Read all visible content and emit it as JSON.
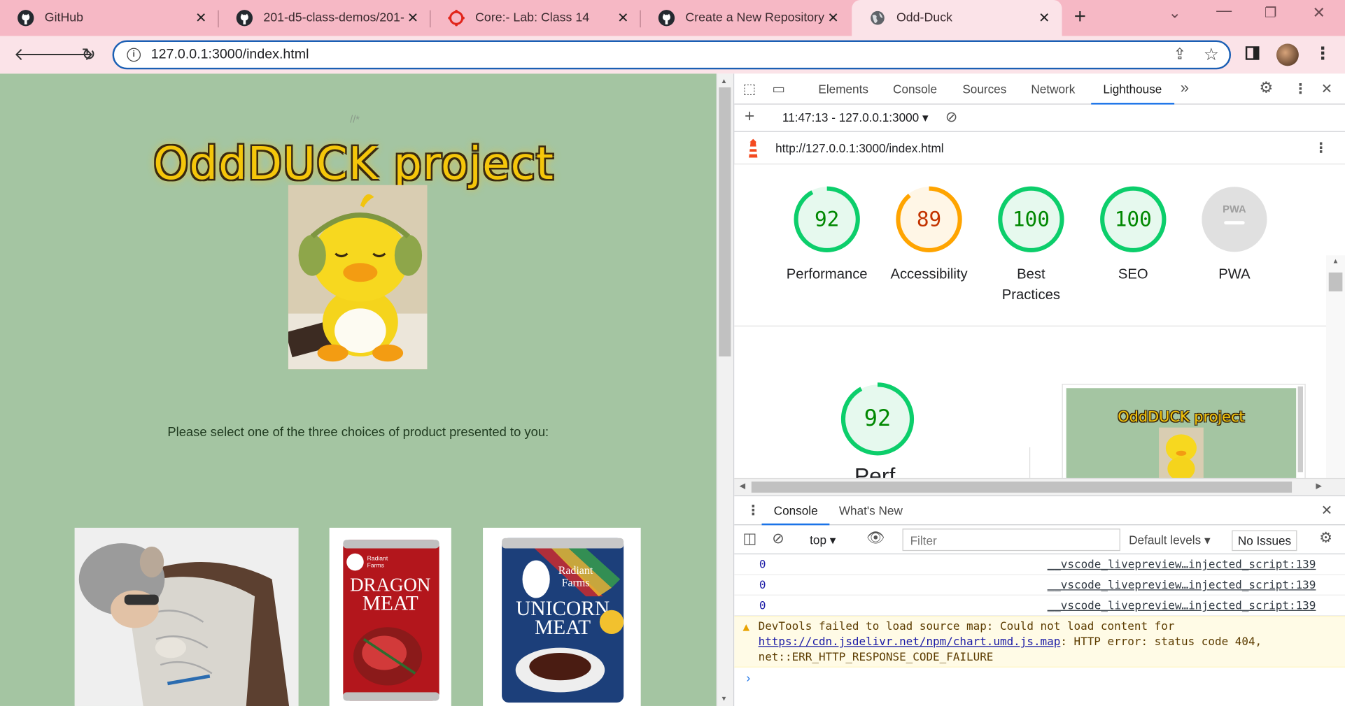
{
  "browser": {
    "tabs": [
      {
        "title": "GitHub",
        "icon": "github-icon"
      },
      {
        "title": "201-d5-class-demos/201-",
        "icon": "github-icon"
      },
      {
        "title": "Core:- Lab: Class 14",
        "icon": "canvas-icon"
      },
      {
        "title": "Create a New Repository",
        "icon": "github-icon"
      },
      {
        "title": "Odd-Duck",
        "icon": "globe-icon"
      }
    ],
    "url": "127.0.0.1:3000/index.html",
    "colors": {
      "tabstrip": "#f6b8c5",
      "toolbar": "#fbe3e8",
      "omnibox_border": "#1a5fb4"
    }
  },
  "page": {
    "comment": "//*",
    "title": "OddDUCK project",
    "prompt": "Please select one of the three choices of product presented to you:",
    "products": [
      {
        "label": "",
        "alt": "sleeping bag"
      },
      {
        "label": "DRAGON MEAT",
        "brand": "Radiant Farms"
      },
      {
        "label": "UNICORN MEAT",
        "brand": "Radiant Farms"
      }
    ],
    "background": "#a4c5a2"
  },
  "devtools": {
    "tabs": [
      "Elements",
      "Console",
      "Sources",
      "Network",
      "Lighthouse"
    ],
    "active_tab": "Lighthouse",
    "report_selector": "11:47:13 - 127.0.0.1:3000",
    "report_url": "http://127.0.0.1:3000/index.html",
    "scores": [
      {
        "label": "Performance",
        "value": "92",
        "color": "#0cce6b",
        "fraction": 0.92
      },
      {
        "label": "Accessibility",
        "value": "89",
        "color": "#ffa400",
        "fraction": 0.89
      },
      {
        "label": "Best Practices",
        "value": "100",
        "color": "#0cce6b",
        "fraction": 1.0
      },
      {
        "label": "SEO",
        "value": "100",
        "color": "#0cce6b",
        "fraction": 1.0
      },
      {
        "label": "PWA",
        "value": "PWA",
        "color": "#bdbdbd",
        "fraction": 0
      }
    ],
    "detail_score": "92",
    "detail_label_partial": "Perf",
    "thumbnail_title": "OddDUCK project",
    "drawer": {
      "tabs": [
        "Console",
        "What's New"
      ],
      "context": "top",
      "filter_placeholder": "Filter",
      "levels": "Default levels",
      "issues": "No Issues",
      "logs": [
        {
          "value": "0",
          "source": "__vscode_livepreview…injected_script:139"
        },
        {
          "value": "0",
          "source": "__vscode_livepreview…injected_script:139"
        },
        {
          "value": "0",
          "source": "__vscode_livepreview…injected_script:139"
        }
      ],
      "warning_text": "DevTools failed to load source map: Could not load content for ",
      "warning_link": "https://cdn.jsdelivr.net/npm/chart.umd.js.map",
      "warning_rest": ": HTTP error: status code 404, net::ERR_HTTP_RESPONSE_CODE_FAILURE"
    }
  }
}
